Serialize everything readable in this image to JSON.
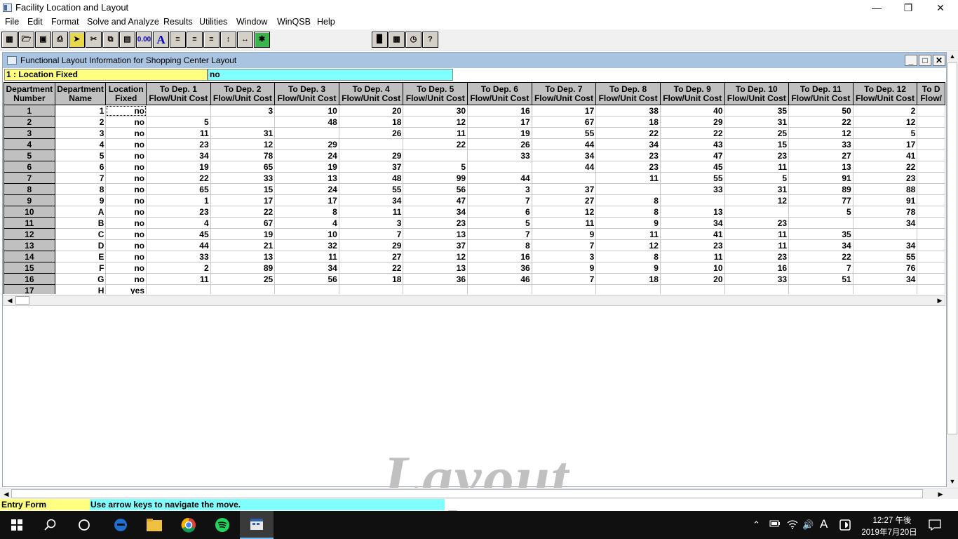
{
  "app": {
    "title": "Facility Location and Layout"
  },
  "menu": [
    "File",
    "Edit",
    "Format",
    "Solve and Analyze",
    "Results",
    "Utilities",
    "Window",
    "WinQSB",
    "Help"
  ],
  "toolbar": {
    "number_format_label": "0.00",
    "font_label": "A"
  },
  "child_window": {
    "title": "Functional Layout Information for Shopping Center Layout",
    "cell_indicator": "1 : Location Fixed",
    "cell_value": "no"
  },
  "grid": {
    "headers": [
      [
        "Department",
        "Number"
      ],
      [
        "Department",
        "Name"
      ],
      [
        "Location",
        "Fixed"
      ],
      [
        "To Dep. 1",
        "Flow/Unit Cost"
      ],
      [
        "To Dep. 2",
        "Flow/Unit Cost"
      ],
      [
        "To Dep. 3",
        "Flow/Unit Cost"
      ],
      [
        "To Dep. 4",
        "Flow/Unit Cost"
      ],
      [
        "To Dep. 5",
        "Flow/Unit Cost"
      ],
      [
        "To Dep. 6",
        "Flow/Unit Cost"
      ],
      [
        "To Dep. 7",
        "Flow/Unit Cost"
      ],
      [
        "To Dep. 8",
        "Flow/Unit Cost"
      ],
      [
        "To Dep. 9",
        "Flow/Unit Cost"
      ],
      [
        "To Dep. 10",
        "Flow/Unit Cost"
      ],
      [
        "To Dep. 11",
        "Flow/Unit Cost"
      ],
      [
        "To Dep. 12",
        "Flow/Unit Cost"
      ],
      [
        "To D",
        "Flow/"
      ]
    ],
    "rows": [
      [
        "1",
        "1",
        "no",
        "",
        "3",
        "10",
        "20",
        "30",
        "16",
        "17",
        "38",
        "40",
        "35",
        "50",
        "2",
        ""
      ],
      [
        "2",
        "2",
        "no",
        "5",
        "",
        "48",
        "18",
        "12",
        "17",
        "67",
        "18",
        "29",
        "31",
        "22",
        "12",
        ""
      ],
      [
        "3",
        "3",
        "no",
        "11",
        "31",
        "",
        "26",
        "11",
        "19",
        "55",
        "22",
        "22",
        "25",
        "12",
        "5",
        ""
      ],
      [
        "4",
        "4",
        "no",
        "23",
        "12",
        "29",
        "",
        "22",
        "26",
        "44",
        "34",
        "43",
        "15",
        "33",
        "17",
        ""
      ],
      [
        "5",
        "5",
        "no",
        "34",
        "78",
        "24",
        "29",
        "",
        "33",
        "34",
        "23",
        "47",
        "23",
        "27",
        "41",
        ""
      ],
      [
        "6",
        "6",
        "no",
        "19",
        "65",
        "19",
        "37",
        "5",
        "",
        "44",
        "23",
        "45",
        "11",
        "13",
        "22",
        ""
      ],
      [
        "7",
        "7",
        "no",
        "22",
        "33",
        "13",
        "48",
        "99",
        "44",
        "",
        "11",
        "55",
        "5",
        "91",
        "23",
        ""
      ],
      [
        "8",
        "8",
        "no",
        "65",
        "15",
        "24",
        "55",
        "56",
        "3",
        "37",
        "",
        "33",
        "31",
        "89",
        "88",
        ""
      ],
      [
        "9",
        "9",
        "no",
        "1",
        "17",
        "17",
        "34",
        "47",
        "7",
        "27",
        "8",
        "",
        "12",
        "77",
        "91",
        ""
      ],
      [
        "10",
        "A",
        "no",
        "23",
        "22",
        "8",
        "11",
        "34",
        "6",
        "12",
        "8",
        "13",
        "",
        "5",
        "78",
        ""
      ],
      [
        "11",
        "B",
        "no",
        "4",
        "67",
        "4",
        "3",
        "23",
        "5",
        "11",
        "9",
        "34",
        "23",
        "",
        "34",
        ""
      ],
      [
        "12",
        "C",
        "no",
        "45",
        "19",
        "10",
        "7",
        "13",
        "7",
        "9",
        "11",
        "41",
        "11",
        "35",
        "",
        ""
      ],
      [
        "13",
        "D",
        "no",
        "44",
        "21",
        "32",
        "29",
        "37",
        "8",
        "7",
        "12",
        "23",
        "11",
        "34",
        "34",
        ""
      ],
      [
        "14",
        "E",
        "no",
        "33",
        "13",
        "11",
        "27",
        "12",
        "16",
        "3",
        "8",
        "11",
        "23",
        "22",
        "55",
        ""
      ],
      [
        "15",
        "F",
        "no",
        "2",
        "89",
        "34",
        "22",
        "13",
        "36",
        "9",
        "9",
        "10",
        "16",
        "7",
        "76",
        ""
      ],
      [
        "16",
        "G",
        "no",
        "11",
        "25",
        "56",
        "18",
        "36",
        "46",
        "7",
        "18",
        "20",
        "33",
        "51",
        "34",
        ""
      ],
      [
        "17",
        "H",
        "yes",
        "",
        "",
        "",
        "",
        "",
        "",
        "",
        "",
        "",
        "",
        "",
        "",
        ""
      ]
    ]
  },
  "watermark": "Layout",
  "status": {
    "mode": "Entry Form",
    "message": "Use arrow keys to navigate the move."
  },
  "taskbar": {
    "time": "12:27 午後",
    "date": "2019年7月20日",
    "ime": "A"
  }
}
